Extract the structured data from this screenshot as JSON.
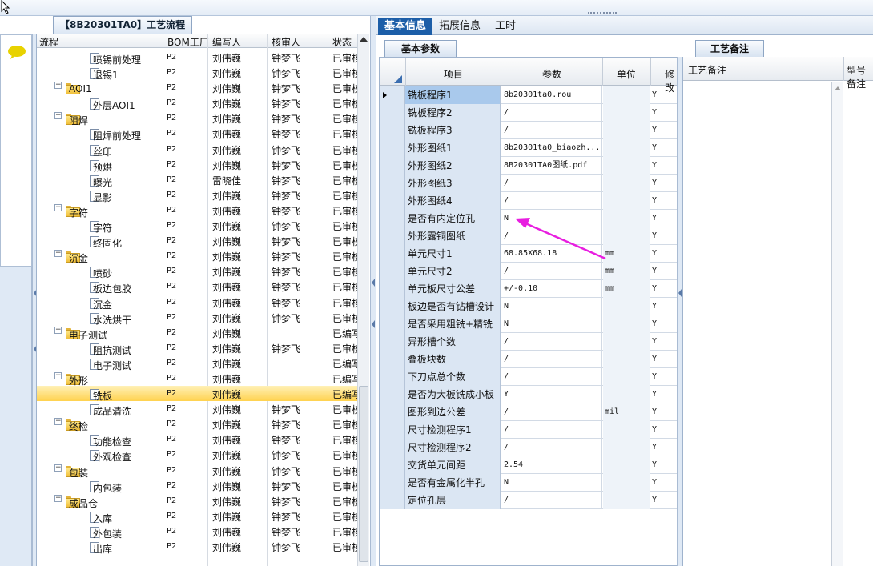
{
  "tree": {
    "title": "【8B20301TA0】工艺流程",
    "columns": [
      "流程",
      "BOM工厂",
      "编写人",
      "核审人",
      "状态"
    ],
    "rows": [
      {
        "level": 1,
        "kind": "doc",
        "label": "喷锡前处理",
        "bom": "P2",
        "writer": "刘伟巍",
        "reviewer": "钟梦飞",
        "status": "已审核"
      },
      {
        "level": 1,
        "kind": "doc",
        "label": "退锡1",
        "bom": "P2",
        "writer": "刘伟巍",
        "reviewer": "钟梦飞",
        "status": "已审核"
      },
      {
        "level": 0,
        "kind": "folder",
        "label": "AOI1",
        "bom": "P2",
        "writer": "刘伟巍",
        "reviewer": "钟梦飞",
        "status": "已审核"
      },
      {
        "level": 1,
        "kind": "doc",
        "label": "外层AOI1",
        "bom": "P2",
        "writer": "刘伟巍",
        "reviewer": "钟梦飞",
        "status": "已审核"
      },
      {
        "level": 0,
        "kind": "folder",
        "label": "阻焊",
        "bom": "P2",
        "writer": "刘伟巍",
        "reviewer": "钟梦飞",
        "status": "已审核"
      },
      {
        "level": 1,
        "kind": "doc",
        "label": "阻焊前处理",
        "bom": "P2",
        "writer": "刘伟巍",
        "reviewer": "钟梦飞",
        "status": "已审核"
      },
      {
        "level": 1,
        "kind": "doc",
        "label": "丝印",
        "bom": "P2",
        "writer": "刘伟巍",
        "reviewer": "钟梦飞",
        "status": "已审核"
      },
      {
        "level": 1,
        "kind": "doc",
        "label": "预烘",
        "bom": "P2",
        "writer": "刘伟巍",
        "reviewer": "钟梦飞",
        "status": "已审核"
      },
      {
        "level": 1,
        "kind": "doc",
        "label": "曝光",
        "bom": "P2",
        "writer": "雷晓佳",
        "reviewer": "钟梦飞",
        "status": "已审核"
      },
      {
        "level": 1,
        "kind": "doc",
        "label": "显影",
        "bom": "P2",
        "writer": "刘伟巍",
        "reviewer": "钟梦飞",
        "status": "已审核"
      },
      {
        "level": 0,
        "kind": "folder",
        "label": "字符",
        "bom": "P2",
        "writer": "刘伟巍",
        "reviewer": "钟梦飞",
        "status": "已审核"
      },
      {
        "level": 1,
        "kind": "doc",
        "label": "字符",
        "bom": "P2",
        "writer": "刘伟巍",
        "reviewer": "钟梦飞",
        "status": "已审核"
      },
      {
        "level": 1,
        "kind": "doc",
        "label": "终固化",
        "bom": "P2",
        "writer": "刘伟巍",
        "reviewer": "钟梦飞",
        "status": "已审核"
      },
      {
        "level": 0,
        "kind": "folder",
        "label": "沉金",
        "bom": "P2",
        "writer": "刘伟巍",
        "reviewer": "钟梦飞",
        "status": "已审核"
      },
      {
        "level": 1,
        "kind": "doc",
        "label": "喷砂",
        "bom": "P2",
        "writer": "刘伟巍",
        "reviewer": "钟梦飞",
        "status": "已审核"
      },
      {
        "level": 1,
        "kind": "doc",
        "label": "板边包胶",
        "bom": "P2",
        "writer": "刘伟巍",
        "reviewer": "钟梦飞",
        "status": "已审核"
      },
      {
        "level": 1,
        "kind": "doc",
        "label": "沉金",
        "bom": "P2",
        "writer": "刘伟巍",
        "reviewer": "钟梦飞",
        "status": "已审核"
      },
      {
        "level": 1,
        "kind": "doc",
        "label": "水洗烘干",
        "bom": "P2",
        "writer": "刘伟巍",
        "reviewer": "钟梦飞",
        "status": "已审核"
      },
      {
        "level": 0,
        "kind": "folder",
        "label": "电子测试",
        "bom": "P2",
        "writer": "刘伟巍",
        "reviewer": "",
        "status": "已编写"
      },
      {
        "level": 1,
        "kind": "doc",
        "label": "阻抗测试",
        "bom": "P2",
        "writer": "刘伟巍",
        "reviewer": "钟梦飞",
        "status": "已审核"
      },
      {
        "level": 1,
        "kind": "doc",
        "label": "电子测试",
        "bom": "P2",
        "writer": "刘伟巍",
        "reviewer": "",
        "status": "已编写"
      },
      {
        "level": 0,
        "kind": "folder",
        "label": "外形",
        "bom": "P2",
        "writer": "刘伟巍",
        "reviewer": "",
        "status": "已编写"
      },
      {
        "level": 1,
        "kind": "doc",
        "label": "铣板",
        "bom": "P2",
        "writer": "刘伟巍",
        "reviewer": "",
        "status": "已编写",
        "selected": true
      },
      {
        "level": 1,
        "kind": "doc",
        "label": "成品清洗",
        "bom": "P2",
        "writer": "刘伟巍",
        "reviewer": "钟梦飞",
        "status": "已审核"
      },
      {
        "level": 0,
        "kind": "folder",
        "label": "终检",
        "bom": "P2",
        "writer": "刘伟巍",
        "reviewer": "钟梦飞",
        "status": "已审核"
      },
      {
        "level": 1,
        "kind": "doc",
        "label": "功能检查",
        "bom": "P2",
        "writer": "刘伟巍",
        "reviewer": "钟梦飞",
        "status": "已审核"
      },
      {
        "level": 1,
        "kind": "doc",
        "label": "外观检查",
        "bom": "P2",
        "writer": "刘伟巍",
        "reviewer": "钟梦飞",
        "status": "已审核"
      },
      {
        "level": 0,
        "kind": "folder",
        "label": "包装",
        "bom": "P2",
        "writer": "刘伟巍",
        "reviewer": "钟梦飞",
        "status": "已审核"
      },
      {
        "level": 1,
        "kind": "doc",
        "label": "内包装",
        "bom": "P2",
        "writer": "刘伟巍",
        "reviewer": "钟梦飞",
        "status": "已审核"
      },
      {
        "level": 0,
        "kind": "folder",
        "label": "成品仓",
        "bom": "P2",
        "writer": "刘伟巍",
        "reviewer": "钟梦飞",
        "status": "已审核"
      },
      {
        "level": 1,
        "kind": "doc",
        "label": "入库",
        "bom": "P2",
        "writer": "刘伟巍",
        "reviewer": "钟梦飞",
        "status": "已审核"
      },
      {
        "level": 1,
        "kind": "doc",
        "label": "外包装",
        "bom": "P2",
        "writer": "刘伟巍",
        "reviewer": "钟梦飞",
        "status": "已审核"
      },
      {
        "level": 1,
        "kind": "doc",
        "label": "出库",
        "bom": "P2",
        "writer": "刘伟巍",
        "reviewer": "钟梦飞",
        "status": "已审核"
      }
    ]
  },
  "tabs": [
    "基本信息",
    "拓展信息",
    "工时"
  ],
  "subtab": "基本参数",
  "grid": {
    "columns": [
      "项目",
      "参数",
      "单位",
      "修改"
    ],
    "rows": [
      {
        "item": "铣板程序1",
        "param": "8b20301ta0.rou",
        "unit": "",
        "mod": "Y",
        "selected": true
      },
      {
        "item": "铣板程序2",
        "param": "/",
        "unit": "",
        "mod": "Y"
      },
      {
        "item": "铣板程序3",
        "param": "/",
        "unit": "",
        "mod": "Y"
      },
      {
        "item": "外形图纸1",
        "param": "8b20301ta0_biaozh...",
        "unit": "",
        "mod": "Y"
      },
      {
        "item": "外形图纸2",
        "param": "8B20301TA0图纸.pdf",
        "unit": "",
        "mod": "Y"
      },
      {
        "item": "外形图纸3",
        "param": "/",
        "unit": "",
        "mod": "Y"
      },
      {
        "item": "外形图纸4",
        "param": "/",
        "unit": "",
        "mod": "Y"
      },
      {
        "item": "是否有内定位孔",
        "param": "N",
        "unit": "",
        "mod": "Y"
      },
      {
        "item": "外形露铜图纸",
        "param": "/",
        "unit": "",
        "mod": "Y"
      },
      {
        "item": "单元尺寸1",
        "param": "68.85X68.18",
        "unit": "mm",
        "mod": "Y"
      },
      {
        "item": "单元尺寸2",
        "param": "/",
        "unit": "mm",
        "mod": "Y"
      },
      {
        "item": "单元板尺寸公差",
        "param": "+/-0.10",
        "unit": "mm",
        "mod": "Y"
      },
      {
        "item": "板边是否有钻槽设计",
        "param": "N",
        "unit": "",
        "mod": "Y"
      },
      {
        "item": "是否采用粗铣+精铣",
        "param": "N",
        "unit": "",
        "mod": "Y"
      },
      {
        "item": "异形槽个数",
        "param": "/",
        "unit": "",
        "mod": "Y"
      },
      {
        "item": "叠板块数",
        "param": "/",
        "unit": "",
        "mod": "Y"
      },
      {
        "item": "下刀点总个数",
        "param": "/",
        "unit": "",
        "mod": "Y"
      },
      {
        "item": "是否为大板铣成小板",
        "param": "Y",
        "unit": "",
        "mod": "Y"
      },
      {
        "item": "图形到边公差",
        "param": "/",
        "unit": "mil",
        "mod": "Y"
      },
      {
        "item": "尺寸检测程序1",
        "param": "/",
        "unit": "",
        "mod": "Y"
      },
      {
        "item": "尺寸检测程序2",
        "param": "/",
        "unit": "",
        "mod": "Y"
      },
      {
        "item": "交货单元间距",
        "param": "2.54",
        "unit": "",
        "mod": "Y"
      },
      {
        "item": "是否有金属化半孔",
        "param": "N",
        "unit": "",
        "mod": "Y"
      },
      {
        "item": "定位孔层",
        "param": "/",
        "unit": "",
        "mod": "Y"
      }
    ]
  },
  "remarks": {
    "tab": "工艺备注",
    "columns": [
      "工艺备注",
      "型号备注"
    ]
  },
  "annotation": {
    "color": "#e81ee0"
  }
}
